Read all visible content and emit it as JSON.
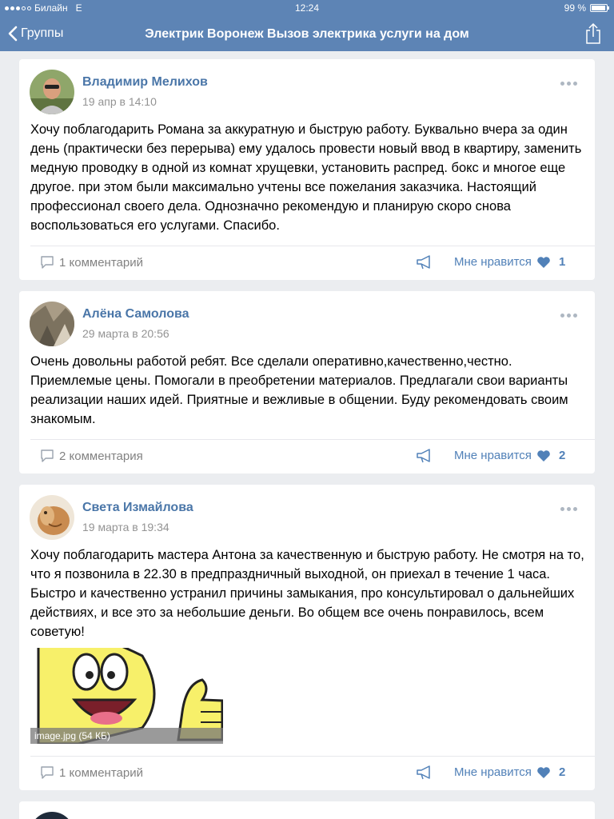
{
  "status": {
    "carrier": "Билайн",
    "network": "E",
    "time": "12:24",
    "battery": "99 %"
  },
  "nav": {
    "back_label": "Группы",
    "title": "Электрик Воронеж Вызов электрика услуги на дом"
  },
  "posts": [
    {
      "author": "Владимир Мелихов",
      "date": "19 апр в 14:10",
      "text": "Хочу поблагодарить Романа за аккуратную и быструю работу. Буквально вчера за один день (практически без перерыва) ему удалось провести новый ввод в квартиру, заменить медную проводку в одной из комнат хрущевки, установить распред. бокс и многое еще другое. при этом были максимально учтены все пожелания заказчика. Настоящий профессионал своего дела. Однозначно рекомендую и планирую скоро снова воспользоваться его услугами. Спасибо.",
      "comments": "1 комментарий",
      "like_label": "Мне нравится",
      "likes": "1"
    },
    {
      "author": "Алёна Самолова",
      "date": "29 марта в 20:56",
      "text": "Очень довольны работой ребят. Все сделали оперативно,качественно,честно. Приемлемые цены. Помогали в преобретении материалов. Предлагали свои варианты реализации наших идей. Приятные и вежливые в общении. Буду рекомендовать своим знакомым.",
      "comments": "2 комментария",
      "like_label": "Мне нравится",
      "likes": "2"
    },
    {
      "author": "Света Измайлова",
      "date": "19 марта в 19:34",
      "text": "Хочу поблагодарить мастера Антона за качественную и быструю работу. Не смотря на то, что я позвонила в 22.30 в предпраздничный выходной, он приехал в течение 1 часа. Быстро и качественно устранил причины замыкания, про консультировал о дальнейших действиях, и все это за небольшие деньги.  Во общем все очень понравилось, всем советую!",
      "attachment": "image.jpg (54 КБ)",
      "comments": "1 комментарий",
      "like_label": "Мне нравится",
      "likes": "2"
    }
  ],
  "colors": {
    "header": "#5d84b5",
    "link": "#4a76a8",
    "like": "#5181b8",
    "background": "#ebedf0"
  },
  "icons": [
    "chevron-left-icon",
    "share-icon",
    "more-icon",
    "comment-icon",
    "repost-icon",
    "heart-icon",
    "battery-icon"
  ]
}
